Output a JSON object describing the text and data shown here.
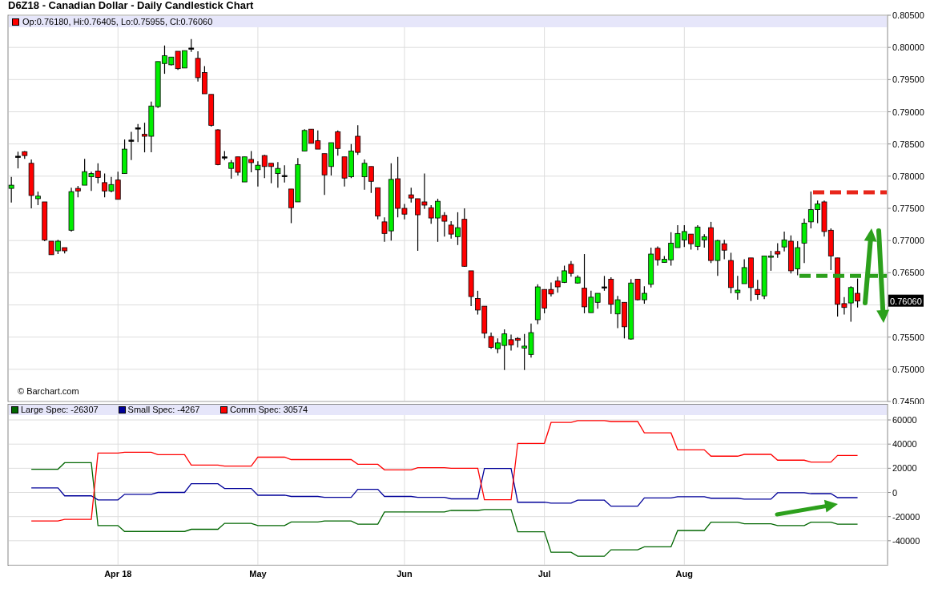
{
  "title": "D6Z18 - Canadian Dollar - Daily Candlestick Chart",
  "price_chart": {
    "legend": "Op:0.76180, Hi:0.76405, Lo:0.75955, Cl:0.76060",
    "credit": "© Barchart.com",
    "chart_data": {
      "type": "candlestick",
      "grid": true,
      "ylim": [
        0.745,
        0.805
      ],
      "yticks": [
        {
          "value": 0.805,
          "label": "0.80500"
        },
        {
          "value": 0.8,
          "label": "0.80000"
        },
        {
          "value": 0.795,
          "label": "0.79500"
        },
        {
          "value": 0.79,
          "label": "0.79000"
        },
        {
          "value": 0.785,
          "label": "0.78500"
        },
        {
          "value": 0.78,
          "label": "0.78000"
        },
        {
          "value": 0.775,
          "label": "0.77500"
        },
        {
          "value": 0.77,
          "label": "0.77000"
        },
        {
          "value": 0.765,
          "label": "0.76500"
        },
        {
          "value": 0.755,
          "label": "0.75500"
        },
        {
          "value": 0.75,
          "label": "0.75000"
        },
        {
          "value": 0.745,
          "label": "0.74500"
        }
      ],
      "categories": [
        null,
        null,
        null,
        null,
        null,
        null,
        null,
        null,
        null,
        null,
        null,
        null,
        null,
        null,
        null,
        null,
        null,
        null,
        null,
        null,
        null,
        null,
        null,
        null,
        null,
        null,
        null,
        null,
        null,
        null,
        null,
        null,
        null,
        null,
        null,
        null,
        null,
        null,
        null,
        null,
        null,
        null,
        null,
        null,
        null,
        null,
        null,
        null,
        null,
        null,
        null,
        null,
        null,
        null,
        null,
        null,
        null,
        null,
        null,
        null,
        null,
        null,
        null,
        null,
        null,
        null,
        null,
        null,
        null,
        null,
        null,
        null,
        null,
        null,
        null,
        null,
        null,
        null,
        null,
        null,
        null,
        null,
        null,
        null,
        null,
        null,
        null,
        null,
        null,
        null,
        null,
        null,
        null,
        null,
        null,
        null,
        null,
        null,
        null,
        null,
        null,
        null,
        null,
        null,
        null,
        null,
        null,
        null,
        null,
        null,
        null,
        null,
        null,
        null,
        null,
        null,
        null,
        null,
        null,
        null,
        null,
        null,
        null,
        null,
        null,
        null,
        null,
        null,
        null,
        null,
        null,
        null
      ],
      "ohlc": [
        [
          0.7781,
          0.7799,
          0.7759,
          0.7786
        ],
        [
          0.7831,
          0.7838,
          0.7812,
          0.7831
        ],
        [
          0.7838,
          0.7839,
          0.7827,
          0.7832
        ],
        [
          0.782,
          0.7826,
          0.775,
          0.777
        ],
        [
          0.7765,
          0.7776,
          0.7755,
          0.7769
        ],
        [
          0.776,
          0.776,
          0.7699,
          0.7701
        ],
        [
          0.7699,
          0.7699,
          0.7678,
          0.7678
        ],
        [
          0.7684,
          0.7701,
          0.7679,
          0.7699
        ],
        [
          0.7689,
          0.7689,
          0.768,
          0.7684
        ],
        [
          0.7716,
          0.7782,
          0.7714,
          0.7776
        ],
        [
          0.7781,
          0.7785,
          0.7767,
          0.7777
        ],
        [
          0.7786,
          0.7827,
          0.7786,
          0.7807
        ],
        [
          0.7799,
          0.7807,
          0.7777,
          0.7804
        ],
        [
          0.7808,
          0.782,
          0.7789,
          0.7798
        ],
        [
          0.779,
          0.7804,
          0.7767,
          0.7777
        ],
        [
          0.7777,
          0.7799,
          0.7775,
          0.7787
        ],
        [
          0.7794,
          0.7807,
          0.7764,
          0.7764
        ],
        [
          0.7804,
          0.7857,
          0.7804,
          0.7842
        ],
        [
          0.7856,
          0.7869,
          0.7825,
          0.7856
        ],
        [
          0.7875,
          0.7881,
          0.7853,
          0.7875
        ],
        [
          0.7865,
          0.7883,
          0.7837,
          0.7862
        ],
        [
          0.7862,
          0.7916,
          0.7837,
          0.7909
        ],
        [
          0.7908,
          0.7978,
          0.7906,
          0.7978
        ],
        [
          0.7975,
          0.8003,
          0.7959,
          0.7987
        ],
        [
          0.7973,
          0.7985,
          0.7972,
          0.7985
        ],
        [
          0.7994,
          0.7994,
          0.7965,
          0.7967
        ],
        [
          0.7968,
          0.7995,
          0.7968,
          0.7995
        ],
        [
          0.7999,
          0.8013,
          0.7993,
          0.7999
        ],
        [
          0.7983,
          0.7994,
          0.7947,
          0.7953
        ],
        [
          0.7961,
          0.7971,
          0.7928,
          0.7928
        ],
        [
          0.7927,
          0.7927,
          0.7877,
          0.7879
        ],
        [
          0.7872,
          0.7873,
          0.7817,
          0.7818
        ],
        [
          0.783,
          0.7839,
          0.7825,
          0.783
        ],
        [
          0.7812,
          0.7825,
          0.7796,
          0.7821
        ],
        [
          0.783,
          0.783,
          0.7801,
          0.7806
        ],
        [
          0.7791,
          0.783,
          0.7791,
          0.783
        ],
        [
          0.7826,
          0.7839,
          0.7806,
          0.7821
        ],
        [
          0.781,
          0.7823,
          0.7784,
          0.7817
        ],
        [
          0.7832,
          0.7833,
          0.7797,
          0.7815
        ],
        [
          0.782,
          0.782,
          0.7789,
          0.7815
        ],
        [
          0.7804,
          0.7822,
          0.7782,
          0.7812
        ],
        [
          0.7801,
          0.7817,
          0.779,
          0.7801
        ],
        [
          0.778,
          0.778,
          0.7727,
          0.7751
        ],
        [
          0.776,
          0.7828,
          0.776,
          0.7818
        ],
        [
          0.7839,
          0.7873,
          0.7839,
          0.7871
        ],
        [
          0.7873,
          0.7873,
          0.7851,
          0.7851
        ],
        [
          0.7855,
          0.7871,
          0.7842,
          0.7842
        ],
        [
          0.7835,
          0.7835,
          0.7771,
          0.7802
        ],
        [
          0.7815,
          0.7852,
          0.7801,
          0.7852
        ],
        [
          0.7869,
          0.7871,
          0.7832,
          0.7843
        ],
        [
          0.783,
          0.783,
          0.7784,
          0.7797
        ],
        [
          0.7799,
          0.785,
          0.7797,
          0.7839
        ],
        [
          0.7862,
          0.7879,
          0.7833,
          0.7837
        ],
        [
          0.7799,
          0.7826,
          0.7779,
          0.782
        ],
        [
          0.7815,
          0.7815,
          0.7774,
          0.7792
        ],
        [
          0.7782,
          0.7782,
          0.7733,
          0.7738
        ],
        [
          0.7729,
          0.7736,
          0.7698,
          0.7711
        ],
        [
          0.7715,
          0.782,
          0.77,
          0.7795
        ],
        [
          0.7796,
          0.783,
          0.7736,
          0.775
        ],
        [
          0.775,
          0.7757,
          0.7733,
          0.7741
        ],
        [
          0.7771,
          0.7782,
          0.7759,
          0.7766
        ],
        [
          0.7765,
          0.7765,
          0.7684,
          0.774
        ],
        [
          0.776,
          0.7804,
          0.7749,
          0.7755
        ],
        [
          0.7751,
          0.7755,
          0.7726,
          0.7735
        ],
        [
          0.7735,
          0.7765,
          0.7698,
          0.7761
        ],
        [
          0.7739,
          0.7744,
          0.7706,
          0.773
        ],
        [
          0.7724,
          0.773,
          0.7703,
          0.771
        ],
        [
          0.7706,
          0.7744,
          0.7693,
          0.772
        ],
        [
          0.7733,
          0.775,
          0.7659,
          0.766
        ],
        [
          0.7653,
          0.7653,
          0.7598,
          0.7613
        ],
        [
          0.761,
          0.7622,
          0.7585,
          0.7592
        ],
        [
          0.7598,
          0.7598,
          0.7548,
          0.7556
        ],
        [
          0.7551,
          0.7557,
          0.7532,
          0.7534
        ],
        [
          0.7532,
          0.7548,
          0.7525,
          0.7541
        ],
        [
          0.7537,
          0.7562,
          0.7499,
          0.7555
        ],
        [
          0.7546,
          0.7554,
          0.7529,
          0.7538
        ],
        [
          0.7548,
          0.755,
          0.7534,
          0.7545
        ],
        [
          0.7533,
          0.7555,
          0.7499,
          0.7536
        ],
        [
          0.7523,
          0.7571,
          0.7518,
          0.7557
        ],
        [
          0.7577,
          0.7632,
          0.757,
          0.7628
        ],
        [
          0.7624,
          0.7624,
          0.7587,
          0.7595
        ],
        [
          0.7624,
          0.7635,
          0.7613,
          0.7617
        ],
        [
          0.7637,
          0.7644,
          0.7619,
          0.7628
        ],
        [
          0.7635,
          0.7661,
          0.7634,
          0.7653
        ],
        [
          0.7663,
          0.7668,
          0.7644,
          0.7649
        ],
        [
          0.7634,
          0.7646,
          0.7633,
          0.7643
        ],
        [
          0.7626,
          0.7679,
          0.7587,
          0.7597
        ],
        [
          0.7588,
          0.7622,
          0.7588,
          0.7612
        ],
        [
          0.7604,
          0.7618,
          0.7594,
          0.7618
        ],
        [
          0.7628,
          0.7645,
          0.7622,
          0.7628
        ],
        [
          0.764,
          0.7643,
          0.7586,
          0.7601
        ],
        [
          0.7586,
          0.7614,
          0.7564,
          0.7608
        ],
        [
          0.7604,
          0.7604,
          0.7548,
          0.7566
        ],
        [
          0.7547,
          0.764,
          0.7546,
          0.7634
        ],
        [
          0.764,
          0.764,
          0.7607,
          0.7608
        ],
        [
          0.7608,
          0.7629,
          0.7602,
          0.7618
        ],
        [
          0.7632,
          0.7689,
          0.7627,
          0.7679
        ],
        [
          0.7688,
          0.7691,
          0.7661,
          0.767
        ],
        [
          0.7666,
          0.7676,
          0.7666,
          0.7671
        ],
        [
          0.767,
          0.7713,
          0.7661,
          0.7696
        ],
        [
          0.7689,
          0.7724,
          0.7689,
          0.7711
        ],
        [
          0.7701,
          0.7724,
          0.769,
          0.7714
        ],
        [
          0.771,
          0.771,
          0.7686,
          0.7695
        ],
        [
          0.7691,
          0.7724,
          0.7685,
          0.7721
        ],
        [
          0.7701,
          0.771,
          0.7689,
          0.7706
        ],
        [
          0.772,
          0.7729,
          0.7665,
          0.7669
        ],
        [
          0.7669,
          0.7701,
          0.7645,
          0.77
        ],
        [
          0.7695,
          0.7701,
          0.7671,
          0.7685
        ],
        [
          0.7669,
          0.7681,
          0.7618,
          0.7627
        ],
        [
          0.7619,
          0.7645,
          0.7608,
          0.7623
        ],
        [
          0.7633,
          0.7671,
          0.7633,
          0.7658
        ],
        [
          0.7673,
          0.7673,
          0.7606,
          0.7627
        ],
        [
          0.7624,
          0.7639,
          0.7608,
          0.7616
        ],
        [
          0.7614,
          0.7676,
          0.7609,
          0.7676
        ],
        [
          0.7674,
          0.7684,
          0.7653,
          0.7676
        ],
        [
          0.7683,
          0.7696,
          0.7673,
          0.7679
        ],
        [
          0.769,
          0.7714,
          0.7683,
          0.7701
        ],
        [
          0.7699,
          0.7708,
          0.7649,
          0.7653
        ],
        [
          0.7656,
          0.7699,
          0.7646,
          0.7689
        ],
        [
          0.7696,
          0.7734,
          0.7665,
          0.7727
        ],
        [
          0.7729,
          0.7776,
          0.7719,
          0.7748
        ],
        [
          0.7748,
          0.7762,
          0.7727,
          0.7757
        ],
        [
          0.776,
          0.7762,
          0.7706,
          0.7714
        ],
        [
          0.7716,
          0.7719,
          0.7654,
          0.7676
        ],
        [
          0.7673,
          0.7673,
          0.7582,
          0.7601
        ],
        [
          0.7602,
          0.7612,
          0.7585,
          0.7596
        ],
        [
          0.7603,
          0.7629,
          0.7574,
          0.7627
        ],
        [
          0.7618,
          0.7641,
          0.7596,
          0.7606
        ],
        null,
        null,
        null,
        null
      ],
      "ref_lines": [
        {
          "axis": "y",
          "value": 0.7775,
          "color": "#e8261b"
        },
        {
          "axis": "y",
          "value": 0.7645,
          "color": "#2ca01c"
        }
      ],
      "annotations": [
        {
          "text": "0.76060",
          "y": 0.7606
        }
      ]
    }
  },
  "cot_chart": {
    "chart_data": {
      "type": "line",
      "grid": true,
      "ylim": [
        -60000,
        64000
      ],
      "categories": [
        null,
        null,
        null,
        null,
        null,
        null,
        null,
        null,
        null,
        null,
        null,
        null,
        null,
        null,
        null,
        null,
        "Apr 18",
        null,
        null,
        null,
        null,
        null,
        null,
        null,
        null,
        null,
        null,
        null,
        null,
        null,
        null,
        null,
        null,
        null,
        null,
        null,
        null,
        "May",
        null,
        null,
        null,
        null,
        null,
        null,
        null,
        null,
        null,
        null,
        null,
        null,
        null,
        null,
        null,
        null,
        null,
        null,
        null,
        null,
        null,
        "Jun",
        null,
        null,
        null,
        null,
        null,
        null,
        null,
        null,
        null,
        null,
        null,
        null,
        null,
        null,
        null,
        null,
        null,
        null,
        null,
        null,
        "Jul",
        null,
        null,
        null,
        null,
        null,
        null,
        null,
        null,
        null,
        null,
        null,
        null,
        null,
        null,
        null,
        null,
        null,
        null,
        null,
        null,
        "Aug",
        null,
        null,
        null,
        null,
        null,
        null,
        null,
        null,
        null,
        null,
        null,
        null,
        null,
        null,
        null,
        null,
        null,
        null,
        null,
        null,
        null,
        null,
        null,
        null,
        null,
        null,
        null,
        null,
        null,
        null
      ],
      "yticks": [
        {
          "value": 60000,
          "label": "60000"
        },
        {
          "value": 40000,
          "label": "40000"
        },
        {
          "value": 20000,
          "label": "20000"
        },
        {
          "value": 0,
          "label": "0"
        },
        {
          "value": -20000,
          "label": "-20000"
        },
        {
          "value": -40000,
          "label": "-40000"
        }
      ],
      "series": [
        {
          "name": "Large Spec: -26307",
          "color": "#006600",
          "values": [
            null,
            null,
            null,
            19200,
            19200,
            19200,
            19200,
            19200,
            24600,
            24600,
            24600,
            24600,
            24600,
            -27400,
            -27400,
            -27400,
            -27400,
            -32300,
            -32300,
            -32300,
            -32300,
            -32300,
            -32300,
            -32300,
            -32300,
            -32300,
            -32300,
            -30500,
            -30500,
            -30500,
            -30500,
            -30500,
            -25600,
            -25600,
            -25600,
            -25600,
            -25600,
            -27400,
            -27400,
            -27400,
            -27400,
            -27400,
            -24400,
            -24400,
            -24400,
            -24400,
            -24400,
            -23600,
            -23600,
            -23600,
            -23600,
            -23600,
            -26200,
            -26200,
            -26200,
            -26200,
            -16200,
            -16200,
            -16200,
            -16200,
            -16200,
            -16200,
            -16200,
            -16200,
            -16200,
            -16200,
            -14900,
            -14900,
            -14900,
            -14900,
            -14900,
            -14200,
            -14200,
            -14200,
            -14200,
            -14200,
            -32500,
            -32500,
            -32500,
            -32500,
            -32500,
            -49500,
            -49500,
            -49500,
            -49500,
            -52800,
            -52800,
            -52800,
            -52800,
            -52800,
            -47500,
            -47500,
            -47500,
            -47500,
            -47500,
            -45000,
            -45000,
            -45000,
            -45000,
            -45000,
            -31500,
            -31500,
            -31500,
            -31500,
            -31500,
            -24600,
            -24600,
            -24600,
            -24600,
            -24600,
            -25900,
            -25900,
            -25900,
            -25900,
            -25900,
            -27400,
            -27400,
            -27400,
            -27400,
            -27400,
            -24600,
            -24600,
            -24600,
            -24600,
            -26300,
            -26300,
            -26300,
            -26300,
            null,
            null,
            null,
            null
          ]
        },
        {
          "name": "Small Spec: -4267",
          "color": "#000099",
          "values": [
            null,
            null,
            null,
            3800,
            3800,
            3800,
            3800,
            3800,
            -2800,
            -2800,
            -2800,
            -2800,
            -2800,
            -6200,
            -6200,
            -6200,
            -6200,
            -1500,
            -1500,
            -1500,
            -1500,
            -1500,
            0,
            0,
            0,
            0,
            0,
            7200,
            7200,
            7200,
            7200,
            7200,
            3300,
            3300,
            3300,
            3300,
            3300,
            -2300,
            -2300,
            -2300,
            -2300,
            -2300,
            -3300,
            -3300,
            -3300,
            -3300,
            -3300,
            -4100,
            -4100,
            -4100,
            -4100,
            -4100,
            2600,
            2600,
            2600,
            2600,
            -3300,
            -3300,
            -3300,
            -3300,
            -3300,
            -4100,
            -4100,
            -4100,
            -4100,
            -4100,
            -5300,
            -5300,
            -5300,
            -5300,
            -5300,
            19800,
            19800,
            19800,
            19800,
            19800,
            -8100,
            -8100,
            -8100,
            -8100,
            -8100,
            -8900,
            -8900,
            -8900,
            -8900,
            -6400,
            -6400,
            -6400,
            -6400,
            -6400,
            -11400,
            -11400,
            -11400,
            -11400,
            -11400,
            -4600,
            -4600,
            -4600,
            -4600,
            -4600,
            -3600,
            -3600,
            -3600,
            -3600,
            -3600,
            -4800,
            -4800,
            -4800,
            -4800,
            -4800,
            -5600,
            -5600,
            -5600,
            -5600,
            -5600,
            -300,
            -300,
            -300,
            -300,
            -300,
            -1000,
            -1000,
            -1000,
            -1000,
            -4300,
            -4300,
            -4300,
            -4300,
            null,
            null,
            null,
            null
          ]
        },
        {
          "name": "Comm Spec: 30574",
          "color": "#ff0000",
          "values": [
            null,
            null,
            null,
            -23600,
            -23600,
            -23600,
            -23600,
            -23600,
            -22300,
            -22300,
            -22300,
            -22300,
            -22300,
            32600,
            32600,
            32600,
            32600,
            33300,
            33300,
            33300,
            33300,
            33300,
            31300,
            31300,
            31300,
            31300,
            31300,
            22600,
            22600,
            22600,
            22600,
            22600,
            21800,
            21800,
            21800,
            21800,
            21800,
            29200,
            29200,
            29200,
            29200,
            29200,
            27200,
            27200,
            27200,
            27200,
            27200,
            27200,
            27200,
            27200,
            27200,
            27200,
            23300,
            23300,
            23300,
            23300,
            18700,
            18700,
            18700,
            18700,
            18700,
            20500,
            20500,
            20500,
            20500,
            20500,
            20000,
            20000,
            20000,
            20000,
            20000,
            -6100,
            -6100,
            -6100,
            -6100,
            -6100,
            40600,
            40600,
            40600,
            40600,
            40600,
            57900,
            57900,
            57900,
            57900,
            59400,
            59400,
            59400,
            59400,
            59400,
            58700,
            58700,
            58700,
            58700,
            58700,
            49300,
            49300,
            49300,
            49300,
            49300,
            35300,
            35300,
            35300,
            35300,
            35300,
            30000,
            30000,
            30000,
            30000,
            30000,
            31500,
            31500,
            31500,
            31500,
            31500,
            26700,
            26700,
            26700,
            26700,
            26700,
            25100,
            25100,
            25100,
            25100,
            30600,
            30600,
            30600,
            30600,
            null,
            null,
            null,
            null
          ]
        }
      ]
    }
  }
}
